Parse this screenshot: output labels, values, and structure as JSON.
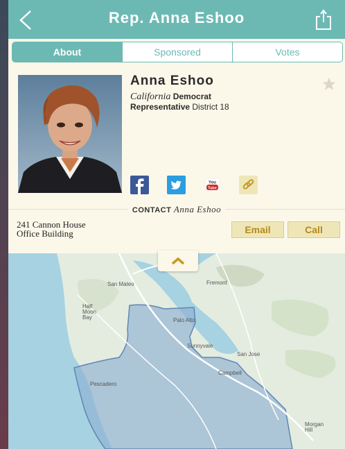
{
  "nav": {
    "title": "Rep. Anna Eshoo"
  },
  "tabs": [
    {
      "label": "About",
      "active": true
    },
    {
      "label": "Sponsored",
      "active": false
    },
    {
      "label": "Votes",
      "active": false
    }
  ],
  "profile": {
    "name": "Anna Eshoo",
    "state": "California",
    "party": "Democrat",
    "role": "Representative",
    "district": "District 18",
    "favorited": false
  },
  "social": [
    "facebook-icon",
    "twitter-icon",
    "youtube-icon",
    "website-link-icon"
  ],
  "contact": {
    "label": "CONTACT",
    "name": "Anna Eshoo",
    "address_line1": "241 Cannon House",
    "address_line2": "Office Building",
    "email_label": "Email",
    "call_label": "Call"
  },
  "map": {
    "labels": {
      "san_mateo": "San Mateo",
      "fremont": "Fremont",
      "half_moon_bay": "Half\nMoon\nBay",
      "palo_alto": "Palo Alto",
      "sunnyvale": "Sunnyvale",
      "san_jose": "San Jose",
      "campbell": "Campbell",
      "pescadero": "Pescadero",
      "morgan_hill": "Morgan\nHill"
    },
    "colors": {
      "water": "#a6d2e2",
      "land": "#e4ece0",
      "district": "#8eb0d3"
    }
  },
  "colors": {
    "accent": "#6cb9b4",
    "button_bg": "#efe6b8",
    "button_text": "#b48a1e"
  }
}
